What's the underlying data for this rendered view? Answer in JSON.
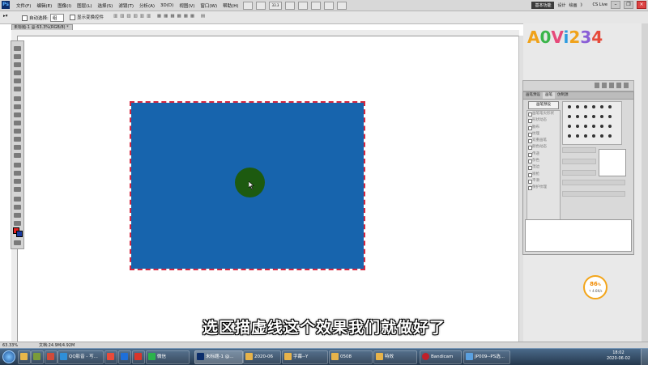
{
  "app": {
    "logo_text": "Ps",
    "menus": [
      "文件(F)",
      "编辑(E)",
      "图像(I)",
      "图层(L)",
      "选择(S)",
      "滤镜(T)",
      "分析(A)",
      "3D(D)",
      "视图(V)",
      "窗口(W)",
      "帮助(H)"
    ],
    "zoom": "33.3",
    "workspace_active": "基本功能",
    "workspaces": [
      "设计",
      "绘画",
      "》"
    ],
    "cs_live": "CS Live"
  },
  "options_bar": {
    "auto_select_label": "自动选择:",
    "auto_select_value": "组",
    "show_transform_label": "显示变换控件"
  },
  "document": {
    "tab_title": "未标题-1 @ 63.3%(RGB/8) *",
    "zoom_status": "63.33%",
    "doc_info": "文档:24.9M/4.92M"
  },
  "canvas": {
    "rect_color": "#1764ad",
    "marquee_color": "#d4283f",
    "circle_color": "#1d5a10"
  },
  "logo_overlay": {
    "top": "A0Vi234",
    "bottom": "A0Vi234"
  },
  "brush_panel": {
    "tabs": [
      "画笔预设",
      "画笔",
      "仿制源"
    ],
    "preset_button": "画笔预设",
    "options": [
      "画笔笔尖形状",
      "形状动态",
      "散布",
      "纹理",
      "双重画笔",
      "颜色动态",
      "传递",
      "杂色",
      "湿边",
      "喷枪",
      "平滑",
      "保护纹理"
    ]
  },
  "progress_widget": {
    "percent": "86",
    "unit": "%",
    "speed": "↑ 4.6K/s"
  },
  "subtitle": "选区描虚线这个效果我们就做好了",
  "taskbar": {
    "items": [
      {
        "label": "QQ影音 - 写...",
        "color": "#2f8fd8"
      },
      {
        "label": "",
        "color": "#e84b3a"
      },
      {
        "label": "",
        "color": "#1e6fd9"
      },
      {
        "label": "",
        "color": "#d9352a"
      },
      {
        "label": "微信",
        "color": "#2bb24c"
      },
      {
        "label": "未标题-1 @...",
        "color": "#0b2d6b"
      },
      {
        "label": "2020-06",
        "color": "#e7b34a"
      },
      {
        "label": "字幕--Y",
        "color": "#e7b34a"
      },
      {
        "label": "0508",
        "color": "#e7b34a"
      },
      {
        "label": "特效",
        "color": "#e7b34a"
      },
      {
        "label": "Bandicam",
        "color": "#c0202a"
      },
      {
        "label": "JP009--PS选...",
        "color": "#5aa0e0"
      }
    ],
    "time": "18:02",
    "date": "2020-06-02"
  }
}
